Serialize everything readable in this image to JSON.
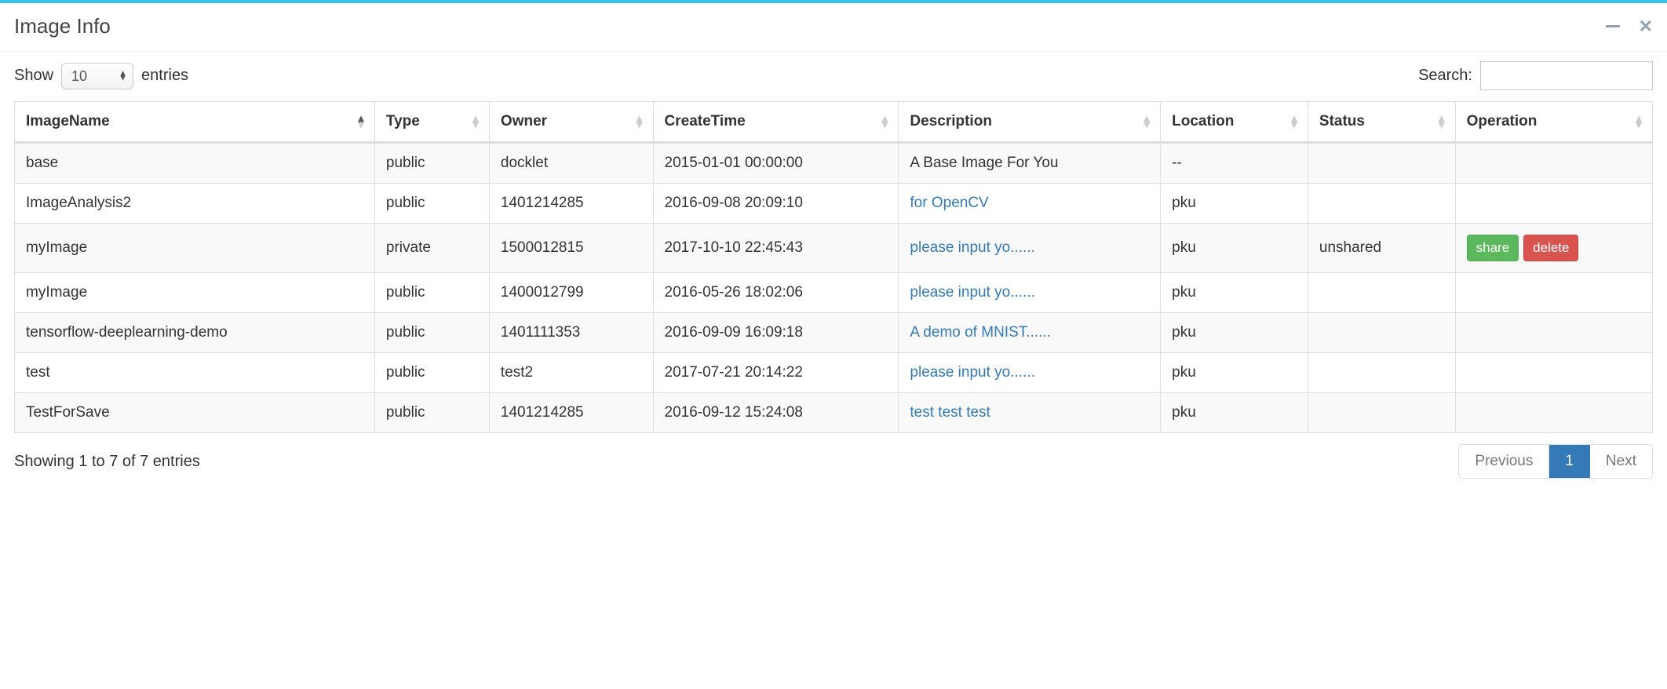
{
  "panel": {
    "title": "Image Info"
  },
  "toolbar": {
    "show_label": "Show",
    "entries_label": "entries",
    "length_value": "10",
    "search_label": "Search:",
    "search_value": ""
  },
  "columns": [
    "ImageName",
    "Type",
    "Owner",
    "CreateTime",
    "Description",
    "Location",
    "Status",
    "Operation"
  ],
  "rows": [
    {
      "imageName": "base",
      "type": "public",
      "owner": "docklet",
      "createTime": "2015-01-01 00:00:00",
      "description": "A Base Image For You",
      "descriptionIsLink": false,
      "location": "--",
      "status": "",
      "operations": []
    },
    {
      "imageName": "ImageAnalysis2",
      "type": "public",
      "owner": "1401214285",
      "createTime": "2016-09-08 20:09:10",
      "description": "for OpenCV",
      "descriptionIsLink": true,
      "location": "pku",
      "status": "",
      "operations": []
    },
    {
      "imageName": "myImage",
      "type": "private",
      "owner": "1500012815",
      "createTime": "2017-10-10 22:45:43",
      "description": "please input yo......",
      "descriptionIsLink": true,
      "location": "pku",
      "status": "unshared",
      "operations": [
        "share",
        "delete"
      ]
    },
    {
      "imageName": "myImage",
      "type": "public",
      "owner": "1400012799",
      "createTime": "2016-05-26 18:02:06",
      "description": "please input yo......",
      "descriptionIsLink": true,
      "location": "pku",
      "status": "",
      "operations": []
    },
    {
      "imageName": "tensorflow-deeplearning-demo",
      "type": "public",
      "owner": "1401111353",
      "createTime": "2016-09-09 16:09:18",
      "description": "A demo of MNIST......",
      "descriptionIsLink": true,
      "location": "pku",
      "status": "",
      "operations": []
    },
    {
      "imageName": "test",
      "type": "public",
      "owner": "test2",
      "createTime": "2017-07-21 20:14:22",
      "description": "please input yo......",
      "descriptionIsLink": true,
      "location": "pku",
      "status": "",
      "operations": []
    },
    {
      "imageName": "TestForSave",
      "type": "public",
      "owner": "1401214285",
      "createTime": "2016-09-12 15:24:08",
      "description": "test test test",
      "descriptionIsLink": true,
      "location": "pku",
      "status": "",
      "operations": []
    }
  ],
  "footer": {
    "info": "Showing 1 to 7 of 7 entries"
  },
  "pagination": {
    "previous": "Previous",
    "next": "Next",
    "current": "1"
  },
  "buttons": {
    "share": "share",
    "delete": "delete"
  }
}
